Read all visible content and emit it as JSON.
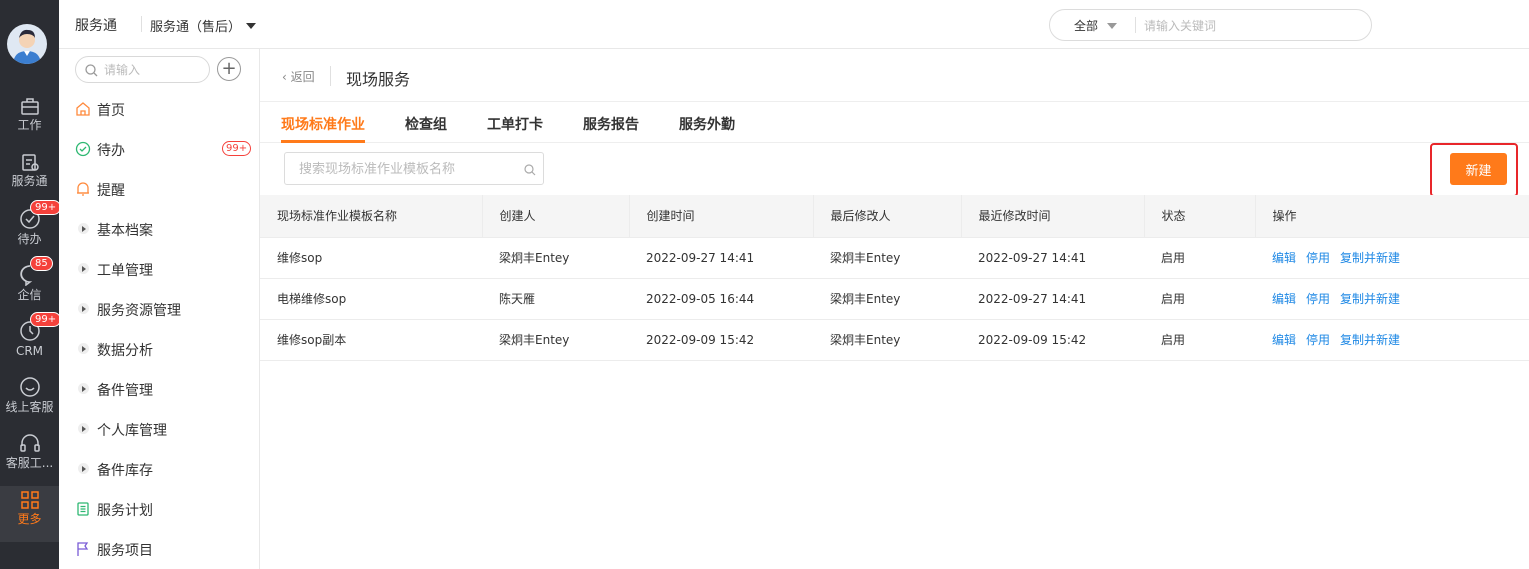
{
  "rail": {
    "items": [
      {
        "label": "工作",
        "icon": "briefcase-icon"
      },
      {
        "label": "服务通",
        "icon": "service-icon"
      },
      {
        "label": "待办",
        "icon": "todo-icon",
        "badge": "99+"
      },
      {
        "label": "企信",
        "icon": "chat-icon",
        "badge": "85"
      },
      {
        "label": "CRM",
        "icon": "clock-icon",
        "badge": "99+"
      },
      {
        "label": "线上客服",
        "icon": "online-service-icon"
      },
      {
        "label": "客服工...",
        "icon": "headset-icon"
      },
      {
        "label": "更多",
        "icon": "grid-icon",
        "active": true
      }
    ]
  },
  "topbar": {
    "brand": "服务通",
    "sub": "服务通（售后）",
    "search_scope": "全部",
    "search_placeholder": "请输入关键词"
  },
  "sidebar": {
    "search_placeholder": "请输入",
    "items": [
      {
        "label": "首页",
        "icon": "home-icon"
      },
      {
        "label": "待办",
        "icon": "check-circle-icon",
        "badge": "99+"
      },
      {
        "label": "提醒",
        "icon": "bell-icon"
      },
      {
        "label": "基本档案",
        "icon": "expand-icon"
      },
      {
        "label": "工单管理",
        "icon": "expand-icon"
      },
      {
        "label": "服务资源管理",
        "icon": "expand-icon"
      },
      {
        "label": "数据分析",
        "icon": "expand-icon"
      },
      {
        "label": "备件管理",
        "icon": "expand-icon"
      },
      {
        "label": "个人库管理",
        "icon": "expand-icon"
      },
      {
        "label": "备件库存",
        "icon": "expand-icon"
      },
      {
        "label": "服务计划",
        "icon": "plan-icon"
      },
      {
        "label": "服务项目",
        "icon": "flag-icon"
      }
    ]
  },
  "main": {
    "back_label": "返回",
    "title": "现场服务",
    "tabs": [
      "现场标准作业",
      "检查组",
      "工单打卡",
      "服务报告",
      "服务外勤"
    ],
    "active_tab": 0,
    "search_placeholder": "搜索现场标准作业模板名称",
    "new_button": "新建"
  },
  "table": {
    "columns": [
      "现场标准作业模板名称",
      "创建人",
      "创建时间",
      "最后修改人",
      "最近修改时间",
      "状态",
      "操作"
    ],
    "rows": [
      {
        "name": "维修sop",
        "creator": "梁炯丰Entey",
        "created": "2022-09-27 14:41",
        "modifier": "梁炯丰Entey",
        "modified": "2022-09-27 14:41",
        "status": "启用"
      },
      {
        "name": "电梯维修sop",
        "creator": "陈天雁",
        "created": "2022-09-05 16:44",
        "modifier": "梁炯丰Entey",
        "modified": "2022-09-27 14:41",
        "status": "启用"
      },
      {
        "name": "维修sop副本",
        "creator": "梁炯丰Entey",
        "created": "2022-09-09 15:42",
        "modifier": "梁炯丰Entey",
        "modified": "2022-09-09 15:42",
        "status": "启用"
      }
    ],
    "actions": [
      "编辑",
      "停用",
      "复制并新建"
    ]
  },
  "colors": {
    "accent": "#ff7a1a",
    "link": "#1e88e5",
    "rail_bg": "#2b2d33",
    "highlight_border": "#e8262a"
  }
}
